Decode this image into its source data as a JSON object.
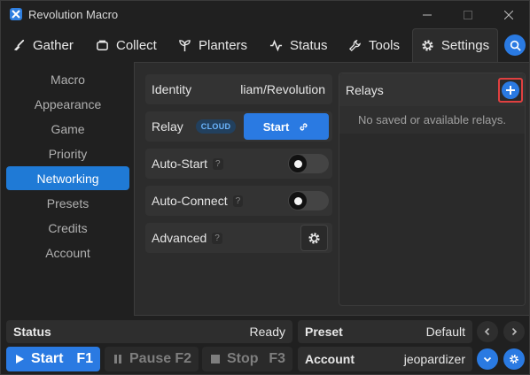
{
  "window": {
    "title": "Revolution Macro"
  },
  "tabs": [
    {
      "label": "Gather",
      "icon": "broom-icon"
    },
    {
      "label": "Collect",
      "icon": "collect-icon"
    },
    {
      "label": "Planters",
      "icon": "sprout-icon"
    },
    {
      "label": "Status",
      "icon": "pulse-icon"
    },
    {
      "label": "Tools",
      "icon": "wrench-icon"
    },
    {
      "label": "Settings",
      "icon": "gear-icon",
      "active": true
    }
  ],
  "sidebar": {
    "items": [
      {
        "label": "Macro"
      },
      {
        "label": "Appearance"
      },
      {
        "label": "Game"
      },
      {
        "label": "Priority"
      },
      {
        "label": "Networking",
        "active": true
      },
      {
        "label": "Presets"
      },
      {
        "label": "Credits"
      },
      {
        "label": "Account"
      }
    ]
  },
  "networking": {
    "identity_label": "Identity",
    "identity_value": "liam/Revolution",
    "relay_label": "Relay",
    "relay_badge": "CLOUD",
    "relay_start_label": "Start",
    "autostart_label": "Auto-Start",
    "autostart_help": "?",
    "autostart_on": false,
    "autoconnect_label": "Auto-Connect",
    "autoconnect_help": "?",
    "autoconnect_on": false,
    "advanced_label": "Advanced",
    "advanced_help": "?"
  },
  "relays": {
    "title": "Relays",
    "empty_text": "No saved or available relays."
  },
  "bottom": {
    "status_label": "Status",
    "status_value": "Ready",
    "preset_label": "Preset",
    "preset_value": "Default",
    "account_label": "Account",
    "account_value": "jeopardizer",
    "start_label": "Start",
    "start_key": "F1",
    "pause_label": "Pause",
    "pause_key": "F2",
    "stop_label": "Stop",
    "stop_key": "F3"
  },
  "colors": {
    "accent": "#2a7ae2",
    "background": "#202020",
    "panel": "#2c2c2c",
    "highlight_border": "#e04040"
  }
}
